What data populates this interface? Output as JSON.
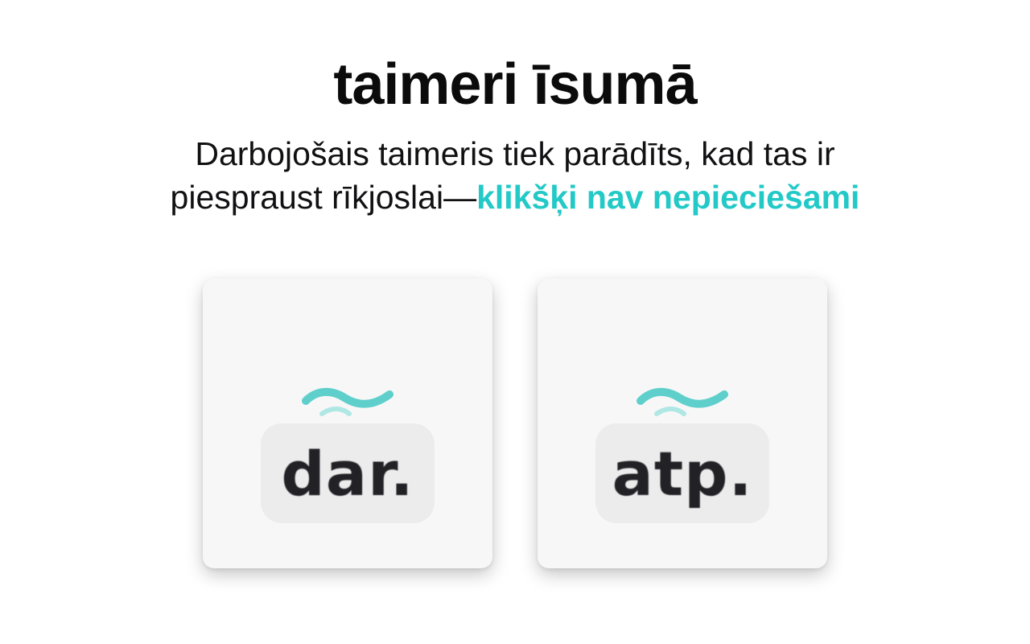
{
  "header": {
    "title": "taimeri īsumā",
    "subtitle_line1": "Darbojošais taimeris tiek parādīts, kad tas ir",
    "subtitle_line2": "piespraust rīkjoslai—",
    "subtitle_accent": "klikšķi nav nepieciešami"
  },
  "cards": [
    {
      "icon": "wave-icon",
      "label": "dar."
    },
    {
      "icon": "wave-icon",
      "label": "atp."
    }
  ],
  "colors": {
    "accent": "#22c9c7",
    "text": "#111113",
    "card_bg": "#f8f7f8",
    "pill_bg": "#ececed"
  }
}
